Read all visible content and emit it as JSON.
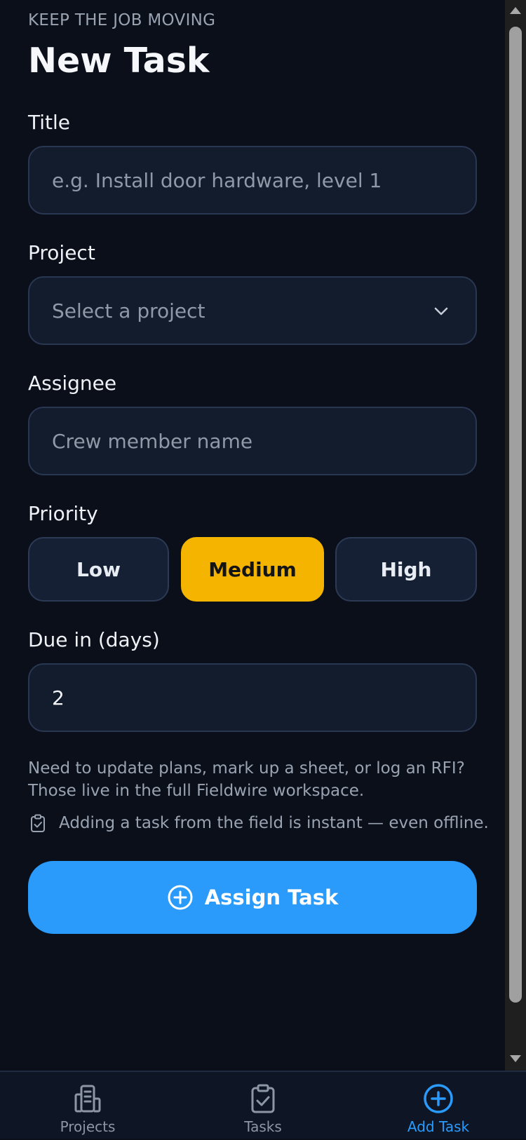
{
  "header": {
    "eyebrow": "KEEP THE JOB MOVING",
    "title": "New Task"
  },
  "form": {
    "title": {
      "label": "Title",
      "placeholder": "e.g. Install door hardware, level 1",
      "value": ""
    },
    "project": {
      "label": "Project",
      "selected": "Select a project"
    },
    "assignee": {
      "label": "Assignee",
      "placeholder": "Crew member name",
      "value": ""
    },
    "priority": {
      "label": "Priority",
      "options": [
        "Low",
        "Medium",
        "High"
      ],
      "selected": "Medium"
    },
    "due": {
      "label": "Due in (days)",
      "value": "2"
    }
  },
  "help_text": "Need to update plans, mark up a sheet, or log an RFI? Those live in the full Fieldwire workspace.",
  "offline_note": {
    "icon": "clipboard-check-icon",
    "text": "Adding a task from the field is instant — even offline."
  },
  "cta": {
    "icon": "plus-circle-icon",
    "label": "Assign Task"
  },
  "tabbar": {
    "tabs": [
      {
        "label": "Projects",
        "icon": "building-icon",
        "active": false
      },
      {
        "label": "Tasks",
        "icon": "clipboard-check-icon",
        "active": false
      },
      {
        "label": "Add Task",
        "icon": "plus-circle-icon",
        "active": true
      }
    ]
  },
  "colors": {
    "background": "#0a0f1a",
    "accent": "#2b9bfb",
    "priority_active": "#f5b400"
  }
}
